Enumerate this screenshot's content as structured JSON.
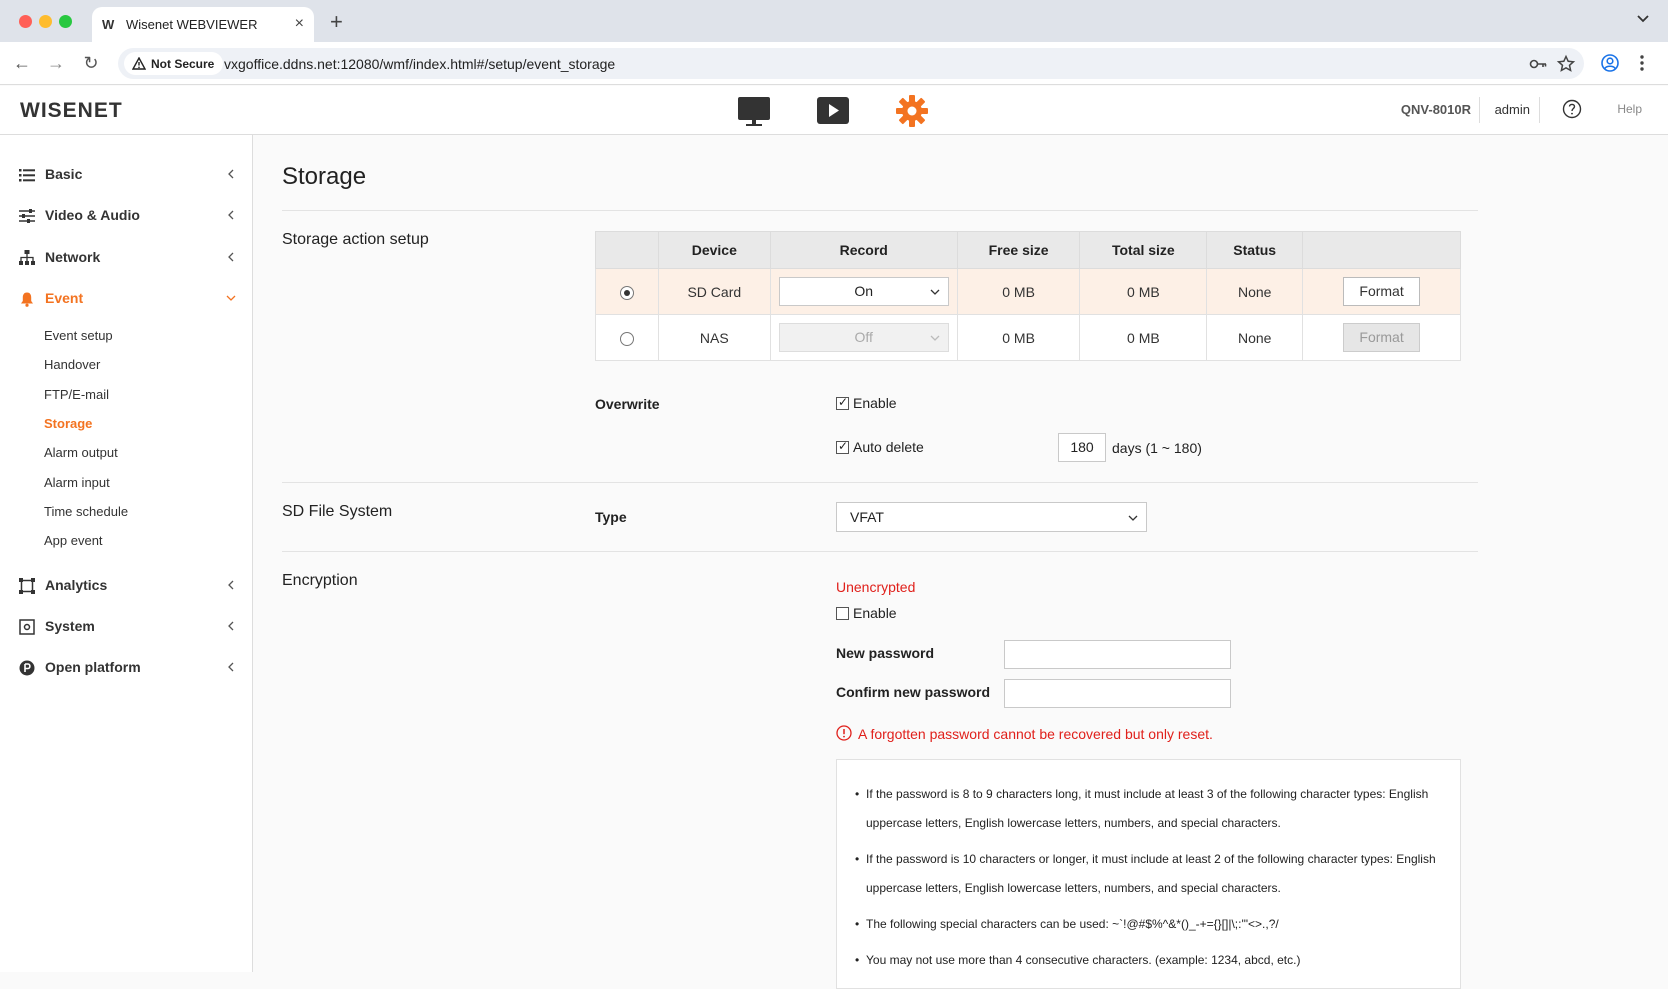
{
  "browser": {
    "tab_title": "Wisenet WEBVIEWER",
    "tab_favicon": "W",
    "security_label": "Not Secure",
    "url": "vxgoffice.ddns.net:12080/wmf/index.html#/setup/event_storage"
  },
  "header": {
    "logo": "WISENET",
    "model": "QNV-8010R",
    "user": "admin",
    "help": "Help",
    "accent": "#f37321"
  },
  "sidebar": {
    "groups": [
      {
        "label": "Basic",
        "icon": "list-icon"
      },
      {
        "label": "Video & Audio",
        "icon": "sliders-icon"
      },
      {
        "label": "Network",
        "icon": "network-icon"
      },
      {
        "label": "Event",
        "icon": "bell-icon"
      },
      {
        "label": "Analytics",
        "icon": "frame-icon"
      },
      {
        "label": "System",
        "icon": "system-icon"
      },
      {
        "label": "Open platform",
        "icon": "platform-icon"
      }
    ],
    "event_items": [
      "Event setup",
      "Handover",
      "FTP/E-mail",
      "Storage",
      "Alarm output",
      "Alarm input",
      "Time schedule",
      "App event"
    ]
  },
  "page": {
    "title": "Storage",
    "storage_action": {
      "section": "Storage action setup",
      "columns": [
        "",
        "Device",
        "Record",
        "Free size",
        "Total size",
        "Status",
        ""
      ],
      "rows": [
        {
          "device": "SD Card",
          "record": "On",
          "free": "0 MB",
          "total": "0 MB",
          "status": "None",
          "action": "Format"
        },
        {
          "device": "NAS",
          "record": "Off",
          "free": "0 MB",
          "total": "0 MB",
          "status": "None",
          "action": "Format"
        }
      ],
      "overwrite_label": "Overwrite",
      "enable_label": "Enable",
      "auto_delete_label": "Auto delete",
      "auto_delete_days": "180",
      "days_range": "days (1 ~ 180)"
    },
    "sd_fs": {
      "section": "SD File System",
      "type_label": "Type",
      "type_value": "VFAT"
    },
    "encryption": {
      "section": "Encryption",
      "status": "Unencrypted",
      "enable_label": "Enable",
      "new_password_label": "New password",
      "confirm_password_label": "Confirm new password",
      "warning": "A forgotten password cannot be recovered but only reset.",
      "rules": [
        "If the password is 8 to 9 characters long, it must include at least 3 of the following character types: English uppercase letters, English lowercase letters, numbers, and special characters.",
        "If the password is 10 characters or longer, it must include at least 2 of the following character types: English uppercase letters, English lowercase letters, numbers, and special characters.",
        "The following special characters can be used: ~`!@#$%^&*()_-+={}[]|\\;:'\"<>.,?/",
        "You may not use more than 4 consecutive characters. (example: 1234, abcd, etc.)"
      ]
    }
  }
}
